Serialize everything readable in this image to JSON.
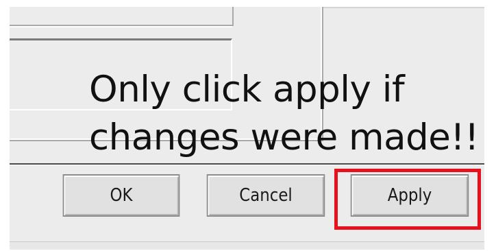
{
  "notice": {
    "text": "Only click apply if\nchanges were made!!"
  },
  "buttons": {
    "ok_label": "OK",
    "cancel_label": "Cancel",
    "apply_label": "Apply"
  },
  "highlight": {
    "target": "apply-button",
    "color": "#e8101d"
  }
}
